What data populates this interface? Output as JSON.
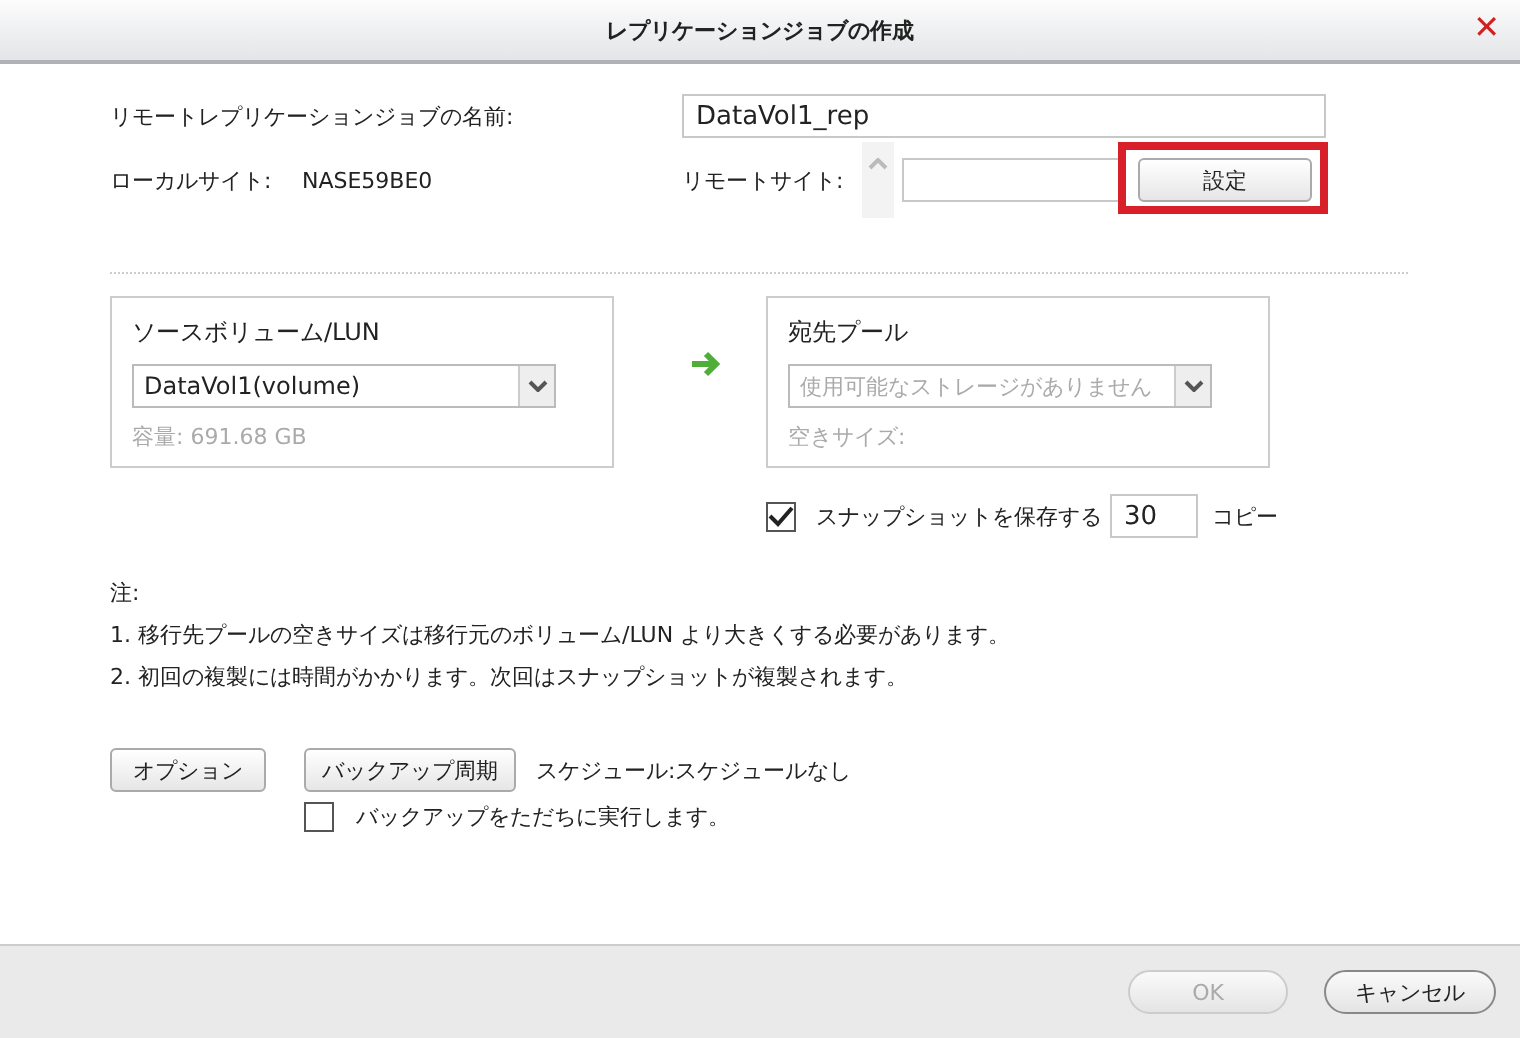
{
  "window": {
    "title": "レプリケーションジョブの作成",
    "close": "✕"
  },
  "job_name": {
    "label": "リモートレプリケーションジョブの名前:",
    "value": "DataVol1_rep"
  },
  "local_site": {
    "label": "ローカルサイト:",
    "value": "NASE59BE0"
  },
  "remote_site": {
    "label": "リモートサイト:",
    "button": {
      "label": "設定",
      "highlighted": true
    }
  },
  "source": {
    "title": "ソースボリューム/LUN",
    "selection": "DataVol1(volume)",
    "disabled": false,
    "capacity": "容量: 691.68 GB"
  },
  "destination": {
    "title": "宛先プール",
    "selection": "使用可能なストレージがありません",
    "disabled": true,
    "free_size": "空きサイズ:"
  },
  "snapshot": {
    "label": "スナップショットを保存する",
    "checked": true,
    "count": "30",
    "unit": "コピー"
  },
  "notes": {
    "heading": "注:",
    "items": [
      "1. 移行先プールの空きサイズは移行元のボリューム/LUN より大きくする必要があります。",
      "2. 初回の複製には時間がかかります。次回はスナップショットが複製されます。"
    ]
  },
  "options_button": "オプション",
  "backup_period_button": "バックアップ周期",
  "schedule": "スケジュール:スケジュールなし",
  "run_now": {
    "label": "バックアップをただちに実行します。",
    "checked": false
  },
  "footer": {
    "buttons": [
      {
        "label": "OK",
        "disabled": true
      },
      {
        "label": "キャンセル",
        "disabled": false
      }
    ]
  }
}
